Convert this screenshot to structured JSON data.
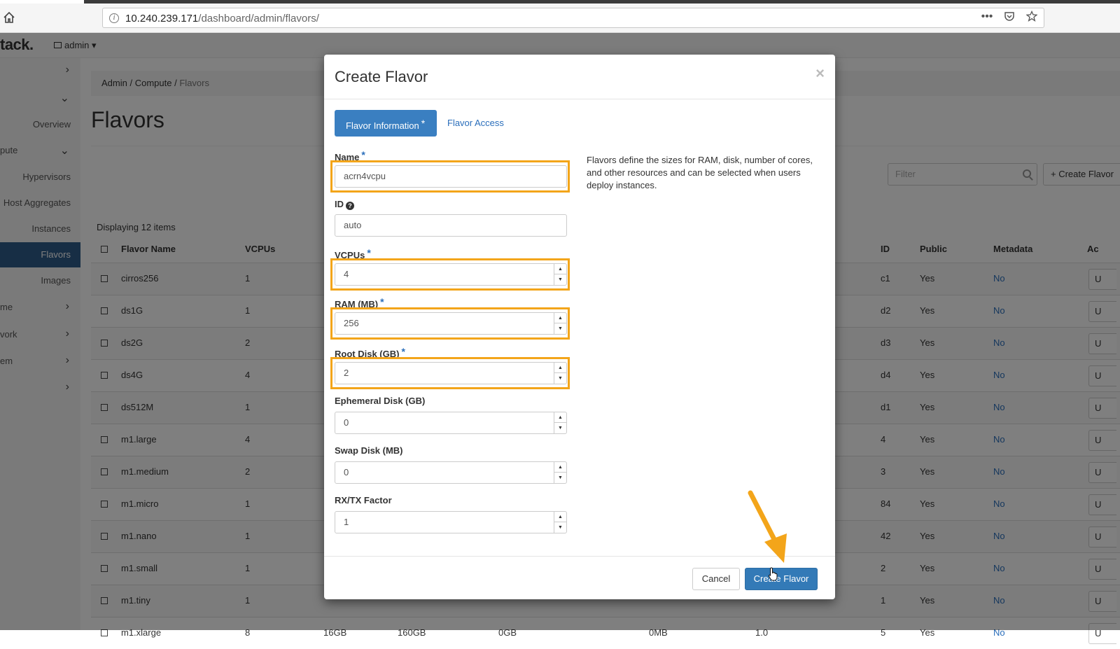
{
  "browser": {
    "url_host": "10.240.239.171",
    "url_path": "/dashboard/admin/flavors/",
    "action_icons": [
      "more-icon",
      "pocket-icon",
      "bookmark-star-icon"
    ]
  },
  "navbar": {
    "brand": "tack.",
    "project_menu": "admin ▾"
  },
  "sidebar": {
    "items": [
      {
        "label": "",
        "chevron": "›"
      },
      {
        "label": "",
        "chevron": "⌄"
      },
      {
        "label": "Overview",
        "chevron": ""
      },
      {
        "label": "pute",
        "chevron": "⌄"
      },
      {
        "label": "Hypervisors",
        "chevron": ""
      },
      {
        "label": "Host Aggregates",
        "chevron": ""
      },
      {
        "label": "Instances",
        "chevron": ""
      },
      {
        "label": "Flavors",
        "chevron": "",
        "active": true
      },
      {
        "label": "Images",
        "chevron": ""
      },
      {
        "label": "me",
        "chevron": "›"
      },
      {
        "label": "vork",
        "chevron": "›"
      },
      {
        "label": "em",
        "chevron": "›"
      },
      {
        "label": "",
        "chevron": "›"
      }
    ]
  },
  "breadcrumb": {
    "admin": "Admin",
    "sep1": "/",
    "compute": "Compute",
    "sep2": "/",
    "current": "Flavors"
  },
  "page": {
    "title": "Flavors",
    "filter_placeholder": "Filter",
    "create_button": "+ Create Flavor",
    "displaying": "Displaying 12 items"
  },
  "table": {
    "headers": {
      "name": "Flavor Name",
      "vcpus": "VCPUs",
      "id": "ID",
      "public": "Public",
      "metadata": "Metadata",
      "actions": "Ac"
    },
    "rows": [
      {
        "name": "cirros256",
        "vcpus": "1",
        "ram": "",
        "root": "",
        "eph": "",
        "swap": "",
        "rxtx": "",
        "id": "c1",
        "public": "Yes",
        "metadata": "No",
        "action": "U"
      },
      {
        "name": "ds1G",
        "vcpus": "1",
        "ram": "",
        "root": "",
        "eph": "",
        "swap": "",
        "rxtx": "",
        "id": "d2",
        "public": "Yes",
        "metadata": "No",
        "action": "U"
      },
      {
        "name": "ds2G",
        "vcpus": "2",
        "ram": "",
        "root": "",
        "eph": "",
        "swap": "",
        "rxtx": "",
        "id": "d3",
        "public": "Yes",
        "metadata": "No",
        "action": "U"
      },
      {
        "name": "ds4G",
        "vcpus": "4",
        "ram": "",
        "root": "",
        "eph": "",
        "swap": "",
        "rxtx": "",
        "id": "d4",
        "public": "Yes",
        "metadata": "No",
        "action": "U"
      },
      {
        "name": "ds512M",
        "vcpus": "1",
        "ram": "",
        "root": "",
        "eph": "",
        "swap": "",
        "rxtx": "",
        "id": "d1",
        "public": "Yes",
        "metadata": "No",
        "action": "U"
      },
      {
        "name": "m1.large",
        "vcpus": "4",
        "ram": "",
        "root": "",
        "eph": "",
        "swap": "",
        "rxtx": "",
        "id": "4",
        "public": "Yes",
        "metadata": "No",
        "action": "U"
      },
      {
        "name": "m1.medium",
        "vcpus": "2",
        "ram": "",
        "root": "",
        "eph": "",
        "swap": "",
        "rxtx": "",
        "id": "3",
        "public": "Yes",
        "metadata": "No",
        "action": "U"
      },
      {
        "name": "m1.micro",
        "vcpus": "1",
        "ram": "",
        "root": "",
        "eph": "",
        "swap": "",
        "rxtx": "",
        "id": "84",
        "public": "Yes",
        "metadata": "No",
        "action": "U"
      },
      {
        "name": "m1.nano",
        "vcpus": "1",
        "ram": "",
        "root": "",
        "eph": "",
        "swap": "",
        "rxtx": "",
        "id": "42",
        "public": "Yes",
        "metadata": "No",
        "action": "U"
      },
      {
        "name": "m1.small",
        "vcpus": "1",
        "ram": "",
        "root": "",
        "eph": "",
        "swap": "",
        "rxtx": "",
        "id": "2",
        "public": "Yes",
        "metadata": "No",
        "action": "U"
      },
      {
        "name": "m1.tiny",
        "vcpus": "1",
        "ram": "",
        "root": "",
        "eph": "",
        "swap": "",
        "rxtx": "",
        "id": "1",
        "public": "Yes",
        "metadata": "No",
        "action": "U"
      },
      {
        "name": "m1.xlarge",
        "vcpus": "8",
        "ram": "16GB",
        "root": "160GB",
        "eph": "0GB",
        "swap": "0MB",
        "rxtx": "1.0",
        "id": "5",
        "public": "Yes",
        "metadata": "No",
        "action": "U"
      }
    ]
  },
  "modal": {
    "title": "Create Flavor",
    "close": "×",
    "tabs": {
      "info": "Flavor Information",
      "access": "Flavor Access",
      "required_mark": "*"
    },
    "fields": {
      "name": {
        "label": "Name",
        "value": "acrn4vcpu"
      },
      "id": {
        "label": "ID",
        "value": "auto"
      },
      "vcpus": {
        "label": "VCPUs",
        "value": "4"
      },
      "ram": {
        "label": "RAM (MB)",
        "value": "256"
      },
      "root_disk": {
        "label": "Root Disk (GB)",
        "value": "2"
      },
      "ephemeral_disk": {
        "label": "Ephemeral Disk (GB)",
        "value": "0"
      },
      "swap_disk": {
        "label": "Swap Disk (MB)",
        "value": "0"
      },
      "rxtx_factor": {
        "label": "RX/TX Factor",
        "value": "1"
      }
    },
    "help_text": "Flavors define the sizes for RAM, disk, number of cores, and other resources and can be selected when users deploy instances.",
    "buttons": {
      "cancel": "Cancel",
      "create": "Create Flavor"
    }
  },
  "colors": {
    "highlight": "#f3a51a",
    "primary": "#337ab7",
    "link": "#2a6ebb",
    "sidebar_active": "#2e5c8a"
  }
}
